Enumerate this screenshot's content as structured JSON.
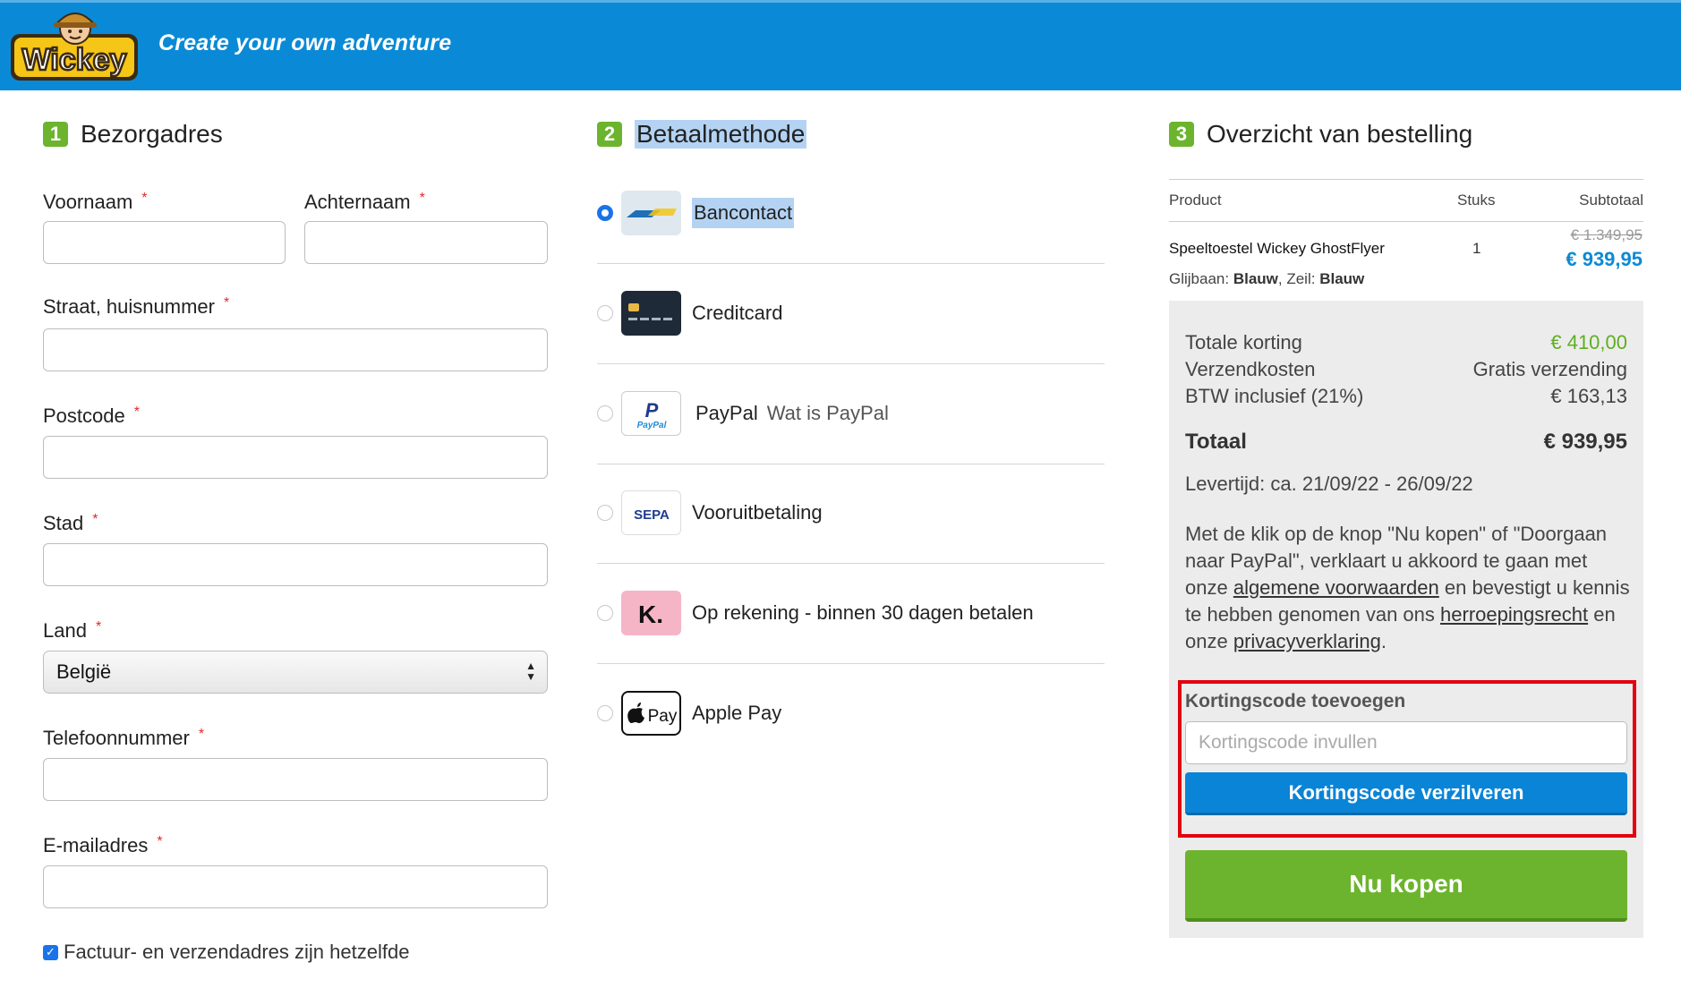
{
  "header": {
    "logo_text": "Wickey",
    "tagline": "Create your own adventure",
    "colors": {
      "bar": "#0a8ad6",
      "logo_yellow": "#f5c518"
    }
  },
  "address": {
    "step_number": "1",
    "title": "Bezorgadres",
    "required_mark": "*",
    "fields": {
      "first_name": {
        "label": "Voornaam",
        "value": ""
      },
      "last_name": {
        "label": "Achternaam",
        "value": ""
      },
      "street": {
        "label": "Straat, huisnummer",
        "value": ""
      },
      "postcode": {
        "label": "Postcode",
        "value": ""
      },
      "city": {
        "label": "Stad",
        "value": ""
      },
      "country": {
        "label": "Land",
        "value": "België"
      },
      "phone": {
        "label": "Telefoonnummer",
        "value": ""
      },
      "email": {
        "label": "E-mailadres",
        "value": ""
      }
    },
    "same_address": {
      "label": "Factuur- en verzendadres zijn hetzelfde",
      "checked": true
    }
  },
  "payment": {
    "step_number": "2",
    "title": "Betaalmethode",
    "selected": "bancontact",
    "methods": [
      {
        "id": "bancontact",
        "label": "Bancontact",
        "icon": "bancontact-icon"
      },
      {
        "id": "creditcard",
        "label": "Creditcard",
        "icon": "credit-card-icon"
      },
      {
        "id": "paypal",
        "label": "PayPal",
        "extra": "Wat is PayPal",
        "icon": "paypal-icon",
        "icon_text": "PayPal"
      },
      {
        "id": "sepa",
        "label": "Vooruitbetaling",
        "icon": "sepa-icon",
        "icon_text": "SEPA"
      },
      {
        "id": "klarna",
        "label": "Op rekening - binnen 30 dagen betalen",
        "icon": "klarna-icon",
        "icon_text": "K."
      },
      {
        "id": "applepay",
        "label": "Apple Pay",
        "icon": "apple-pay-icon",
        "icon_text": "Pay"
      }
    ]
  },
  "order": {
    "step_number": "3",
    "title": "Overzicht van bestelling",
    "columns": {
      "product": "Product",
      "qty": "Stuks",
      "subtotal": "Subtotaal"
    },
    "item": {
      "name": "Speeltoestel Wickey GhostFlyer",
      "variant_prefix_1": "Glijbaan: ",
      "variant_value_1": "Blauw",
      "variant_prefix_2": ", Zeil: ",
      "variant_value_2": "Blauw",
      "qty": "1",
      "old_price": "€ 1.349,95",
      "price": "€ 939,95"
    },
    "summary": {
      "discount_label": "Totale korting",
      "discount_value": "€ 410,00",
      "shipping_label": "Verzendkosten",
      "shipping_value": "Gratis verzending",
      "vat_label": "BTW inclusief (21%)",
      "vat_value": "€ 163,13",
      "total_label": "Totaal",
      "total_value": "€ 939,95",
      "delivery": "Levertijd: ca. 21/09/22 - 26/09/22"
    },
    "legal": {
      "part1": "Met de klik op de knop \"Nu kopen\" of \"Doorgaan naar PayPal\", verklaart u akkoord te gaan met onze ",
      "link_terms": "algemene voorwaarden",
      "part2": " en bevestigt u kennis te hebben genomen van ons ",
      "link_withdrawal": "herroepingsrecht",
      "part3": " en onze ",
      "link_privacy": "privacyverklaring",
      "part4": "."
    },
    "coupon": {
      "title": "Kortingscode toevoegen",
      "placeholder": "Kortingscode invullen",
      "button": "Kortingscode verzilveren"
    },
    "buy_button": "Nu kopen"
  }
}
